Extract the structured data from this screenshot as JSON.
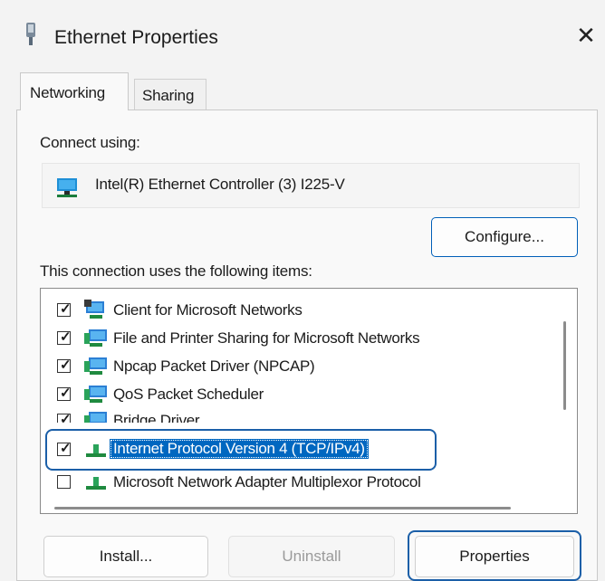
{
  "window": {
    "title": "Ethernet Properties",
    "close_glyph": "✕",
    "title_icon": "network-adapter-icon"
  },
  "tabs": [
    {
      "label": "Networking",
      "active": true
    },
    {
      "label": "Sharing",
      "active": false
    }
  ],
  "connect_using": {
    "label": "Connect using:",
    "adapter_name": "Intel(R) Ethernet Controller (3) I225-V",
    "adapter_icon": "network-adapter-icon",
    "configure_label": "Configure..."
  },
  "items_section": {
    "label": "This connection uses the following items:",
    "items": [
      {
        "label": "Client for Microsoft Networks",
        "checked": true,
        "icon": "network-client-icon"
      },
      {
        "label": "File and Printer Sharing for Microsoft Networks",
        "checked": true,
        "icon": "network-service-icon"
      },
      {
        "label": "Npcap Packet Driver (NPCAP)",
        "checked": true,
        "icon": "network-service-icon"
      },
      {
        "label": "QoS Packet Scheduler",
        "checked": true,
        "icon": "network-service-icon"
      },
      {
        "label": "Bridge Driver",
        "checked": true,
        "icon": "network-service-icon"
      },
      {
        "label": "Internet Protocol Version 4 (TCP/IPv4)",
        "checked": true,
        "icon": "protocol-icon",
        "selected": true
      },
      {
        "label": "Microsoft Network Adapter Multiplexor Protocol",
        "checked": false,
        "icon": "protocol-icon"
      }
    ]
  },
  "buttons": {
    "install": "Install...",
    "uninstall": "Uninstall",
    "properties": "Properties"
  },
  "colors": {
    "selection": "#0067c0",
    "highlight_outline": "#1b5fa8"
  }
}
